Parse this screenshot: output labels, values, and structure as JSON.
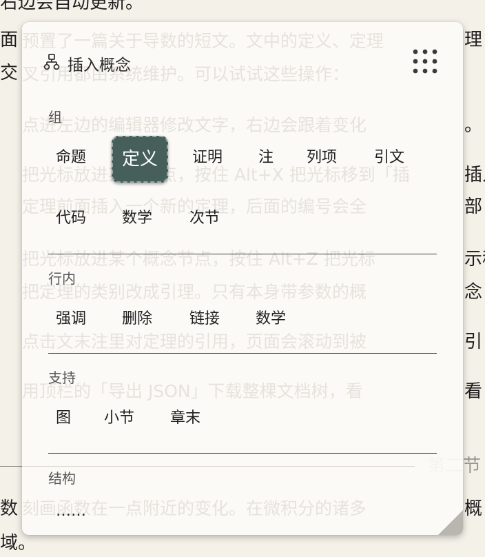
{
  "background": {
    "lines_left": [
      "右边会自动更新。",
      "面",
      "交",
      "数",
      "域。"
    ],
    "lines_right": [
      "理",
      "。",
      "插入",
      "部",
      "示移",
      "念",
      "引",
      "看",
      "第二节",
      "概"
    ]
  },
  "ghost": {
    "lines": [
      "预置了一篇关于导数的短文。文中的定义、定理",
      "叉引用都由系统维护。可以试试这些操作：",
      "点进左边的编辑器修改文字，右边会跟着变化",
      "把光标放进某个节点，按住 Alt+X 把光标移到「插",
      "定理前面插入一个新的定理，后面的编号会全",
      "把光标放进某个概念节点，按住 Alt+Z 把光标",
      "把定理的类别改成引理。只有本身带参数的概",
      "点击文末注里对定理的引用，页面会滚动到被",
      "用顶栏的「导出 JSON」下载整棵文档树，看",
      "刻画函数在一点附近的变化。在微积分的诸多"
    ]
  },
  "panel": {
    "title": "插入概念",
    "icons": {
      "title": "hierarchy-icon",
      "grip": "grip-dots-icon",
      "resize": "resize-corner-icon"
    },
    "accent_color": "#465f5b",
    "sections": [
      {
        "id": "group",
        "label": "组",
        "items": [
          "命题",
          "定义",
          "证明",
          "注",
          "列项",
          "引文",
          "代码",
          "数学",
          "次节"
        ],
        "active_index": 1
      },
      {
        "id": "inline",
        "label": "行内",
        "items": [
          "强调",
          "删除",
          "链接",
          "数学"
        ]
      },
      {
        "id": "support",
        "label": "支持",
        "items": [
          "图",
          "小节",
          "章末"
        ]
      },
      {
        "id": "structure",
        "label": "结构",
        "items": [
          "……"
        ]
      }
    ]
  }
}
